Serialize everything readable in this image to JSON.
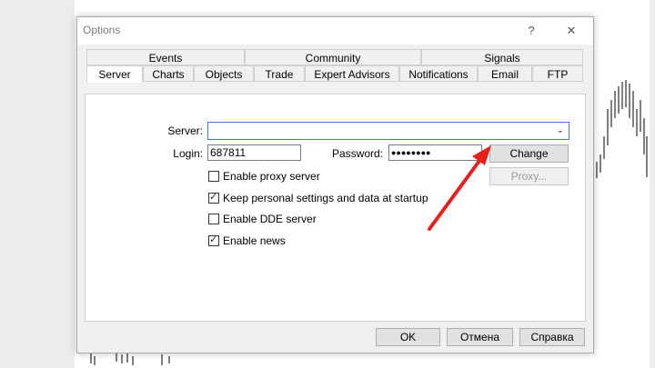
{
  "window": {
    "title": "Options",
    "help_glyph": "?",
    "close_glyph": "✕"
  },
  "tabs_top": [
    {
      "label": "Events"
    },
    {
      "label": "Community"
    },
    {
      "label": "Signals"
    }
  ],
  "tabs_bottom": [
    {
      "label": "Server",
      "active": true
    },
    {
      "label": "Charts"
    },
    {
      "label": "Objects"
    },
    {
      "label": "Trade"
    },
    {
      "label": "Expert Advisors"
    },
    {
      "label": "Notifications"
    },
    {
      "label": "Email"
    },
    {
      "label": "FTP"
    }
  ],
  "server": {
    "server_label": "Server:",
    "server_value": "",
    "login_label": "Login:",
    "login_value": "687811",
    "password_label": "Password:",
    "password_value": "●●●●●●●●",
    "change_button": "Change",
    "proxy_button": "Proxy..."
  },
  "checkboxes": [
    {
      "label": "Enable proxy server",
      "checked": false
    },
    {
      "label": "Keep personal settings and data at startup",
      "checked": true
    },
    {
      "label": "Enable DDE server",
      "checked": false
    },
    {
      "label": "Enable news",
      "checked": true
    }
  ],
  "footer": {
    "ok": "OK",
    "cancel": "Отмена",
    "help": "Справка"
  },
  "colors": {
    "annotation_arrow": "#e8201c",
    "focus_border": "#3a7bd5"
  }
}
